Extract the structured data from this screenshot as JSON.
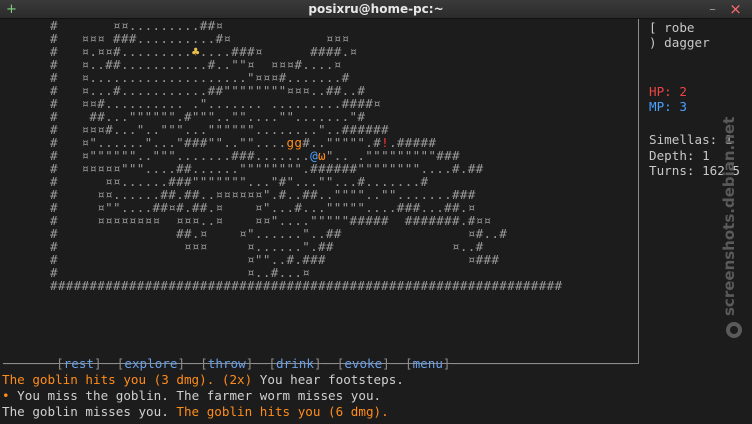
{
  "window": {
    "title": "posixru@home-pc:~"
  },
  "map": {
    "rows": [
      "#       ¤¤.........##¤",
      "#   ¤¤¤ ###..........#¤            ¤¤¤",
      "#   ¤.¤¤#.........♣....###¤      ####.¤",
      "#   ¤..##...........#..\"\"¤  ¤¤¤#....¤",
      "#   ¤....................\"¤¤¤#.......#",
      "#   ¤...#...........##\"\"\"\"\"\"\"\"¤¤¤..##..#",
      "#   ¤¤#.......... .\"....... .........####¤",
      "#    ##...\"\"\"\"\"\".#\"\"\"..\"\"....\"\".......\"#",
      "#   ¤¤¤#...\"..\"\"\"...\"\"\"\"\"\"........\"..######",
      "#   ¤\"......\"...\"###\"\"..\"\"....gg#..\"\"\"\"\".#!.#####",
      "#   ¤\"\"\"\"\"\"..\"\"\".......###.......@ω\".. .\"\"\"\"\"\"\"\"\"###",
      "#   ¤¤¤¤¤\"\"\"....##......\"\"\"\"\"\"\"\".######\"\"\"\"\"\"\"\"....#.##",
      "#      ¤¤......###\"\"\"\"\"\"\"...\"#\"...\"\"...#.......#",
      "#     ¤¤......##.##..¤¤¤¤¤¤\".#..##..\"\"\"\"..\"\".......###",
      "#     ¤\"\"....##¤#.##.¤    ¤\"...#...\"\"\"\"\"....###...##.¤",
      "#     ¤¤¤¤¤¤¤¤  ¤¤¤..¤    ¤¤\"....\"\"\"\"\"#####  #######.#¤¤",
      "#               ##.¤    ¤\"......\"..##                ¤#..#",
      "#                ¤¤¤     ¤......\".##               ¤..#",
      "#                        ¤\"\"..#.###                  ¤###",
      "#                        ¤..#...¤",
      "#################################################################"
    ]
  },
  "sidebar": {
    "equipment": [
      "[ robe",
      ") dagger"
    ],
    "hp_label": "HP: 2",
    "mp_label": "MP: 3",
    "simellas": "Simellas: 1",
    "depth": "Depth: 1",
    "turns": "Turns: 162.5"
  },
  "menu": {
    "items": [
      "rest",
      "explore",
      "throw",
      "drink",
      "evoke",
      "menu"
    ]
  },
  "log": [
    {
      "orange": "The goblin hits you (3 dmg). (2x)",
      "white": " You hear footsteps."
    },
    {
      "marker": "•",
      "white": " You miss the goblin. The farmer worm misses you."
    },
    {
      "white": "The goblin misses you. ",
      "orange": "The goblin hits you (6 dmg)."
    }
  ],
  "watermark": {
    "text": "screenshots.debian.net"
  },
  "colors": {
    "accent_orange": "#ff8c1a",
    "hp_red": "#ee4444",
    "mp_blue": "#4aa0ff",
    "menu_blue": "#6aa0e8"
  }
}
